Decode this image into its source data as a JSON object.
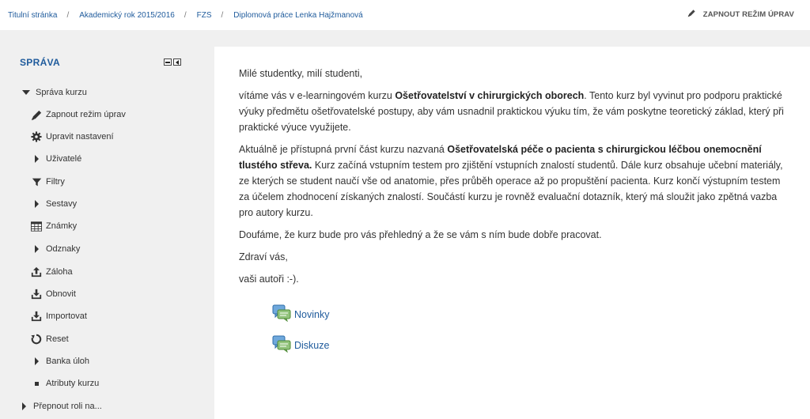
{
  "breadcrumb": {
    "items": [
      "Titulní stránka",
      "Akademický rok 2015/2016",
      "FZS",
      "Diplomová práce Lenka Hajžmanová"
    ],
    "separator": "/"
  },
  "header": {
    "edit_toggle_label": "ZAPNOUT REŽIM ÚPRAV"
  },
  "sidebar": {
    "title": "SPRÁVA",
    "items": [
      {
        "label": "Správa kurzu",
        "icon": "caret-down-icon"
      },
      {
        "label": "Zapnout režim úprav",
        "icon": "pencil-icon"
      },
      {
        "label": "Upravit nastavení",
        "icon": "gear-icon"
      },
      {
        "label": "Uživatelé",
        "icon": "caret-right-icon"
      },
      {
        "label": "Filtry",
        "icon": "filter-icon"
      },
      {
        "label": "Sestavy",
        "icon": "caret-right-icon"
      },
      {
        "label": "Známky",
        "icon": "table-icon"
      },
      {
        "label": "Odznaky",
        "icon": "caret-right-icon"
      },
      {
        "label": "Záloha",
        "icon": "upload-icon"
      },
      {
        "label": "Obnovit",
        "icon": "download-icon"
      },
      {
        "label": "Importovat",
        "icon": "download-icon"
      },
      {
        "label": "Reset",
        "icon": "reset-icon"
      },
      {
        "label": "Banka úloh",
        "icon": "caret-right-icon"
      },
      {
        "label": "Atributy kurzu",
        "icon": "bullet-icon"
      },
      {
        "label": "Přepnout roli na...",
        "icon": "caret-right-icon"
      }
    ]
  },
  "main": {
    "greeting": "Milé studentky, milí studenti,",
    "p1": {
      "a": "vítáme vás v e-learningovém kurzu ",
      "b": "Ošetřovatelství v chirurgických oborech",
      "c": ". Tento kurz byl vyvinut pro podporu praktické výuky předmětu ošetřovatelské postupy, aby vám usnadnil praktickou výuku tím, že vám poskytne teoretický základ, který při praktické výuce využijete."
    },
    "p2": {
      "a": "Aktuálně je přístupná první část kurzu nazvaná ",
      "b": "Ošetřovatelská péče o pacienta s chirurgickou léčbou onemocnění tlustého střeva.",
      "c": " Kurz začíná vstupním testem pro zjištění vstupních znalostí studentů. Dále kurz obsahuje učební materiály, ze kterých se student naučí vše od anatomie, přes průběh operace až po propuštění pacienta. Kurz končí výstupním testem za účelem zhodnocení získaných znalostí. Součástí kurzu je rovněž evaluační dotazník, který má sloužit jako zpětná vazba pro autory kurzu."
    },
    "p3": "Doufáme, že kurz bude pro vás přehledný a že se vám s ním bude dobře pracovat.",
    "p4": "Zdraví vás,",
    "p5": "vaši autoři :-).",
    "activities": [
      {
        "label": "Novinky",
        "icon": "forum-icon"
      },
      {
        "label": "Diskuze",
        "icon": "forum-icon"
      }
    ]
  },
  "colors": {
    "link": "#1f5b9c",
    "sidebar_bg": "#f0f0f0",
    "content_bg": "#ffffff"
  }
}
